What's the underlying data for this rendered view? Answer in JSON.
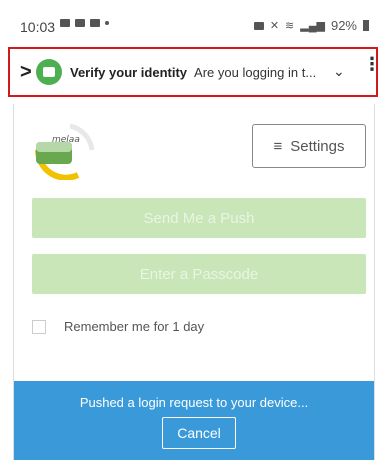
{
  "status_bar": {
    "time": "10:03",
    "battery": "92%",
    "left_icons": [
      "chat-icon",
      "mail-icon",
      "gallery-icon",
      "dot-icon"
    ],
    "right_icons": [
      "alarm-icon",
      "mute-icon",
      "wifi-icon",
      "signal-icon",
      "battery-icon"
    ]
  },
  "notification": {
    "title": "Verify your identity",
    "text": "Are you logging in t...",
    "icon": "app-icon",
    "expand_icon": "chevron-down-icon",
    "more_icon": "kebab-icon",
    "highlight_color": "#d11a1a"
  },
  "app": {
    "logo_text": "melaa",
    "settings_label": "Settings",
    "push_button": "Send Me a Push",
    "passcode_button": "Enter a Passcode",
    "remember_label": "Remember me for 1 day",
    "footer_message": "Pushed a login request to your device...",
    "cancel_label": "Cancel",
    "accent_color": "#3a9ad9",
    "button_color": "#c8e6b8"
  }
}
